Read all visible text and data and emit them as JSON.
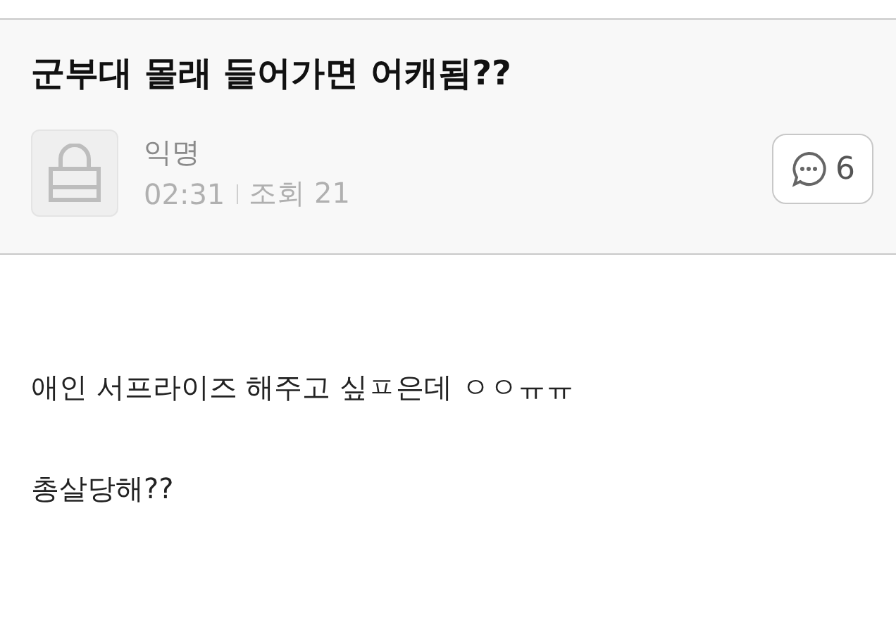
{
  "post": {
    "title": "군부대 몰래 들어가면 어캐됨??",
    "author": "익명",
    "time": "02:31",
    "views": "조회 21",
    "comment_count": "6"
  },
  "body": [
    "애인 서프라이즈 해주고 싶ㅍ은데 ㅇㅇㅠㅠ",
    "총살당해??"
  ]
}
